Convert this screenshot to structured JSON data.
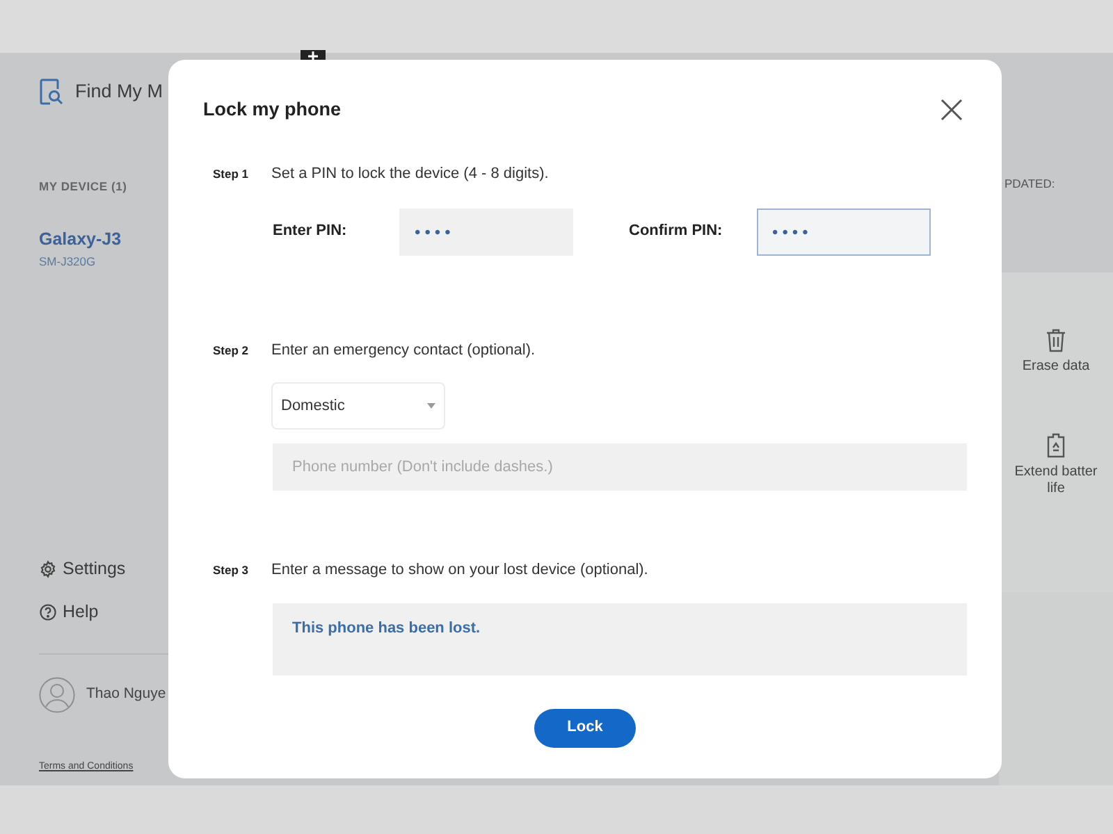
{
  "app": {
    "title": "Find My M"
  },
  "sidebar": {
    "section_label": "MY DEVICE (1)",
    "device": {
      "name": "Galaxy-J3",
      "model": "SM-J320G"
    },
    "links": [
      {
        "label": "Settings"
      },
      {
        "label": "Help"
      }
    ],
    "user": {
      "name": "Thao Nguye"
    },
    "footer_link": "Terms and Conditions"
  },
  "device_panel": {
    "status_label": "PDATED:",
    "actions": [
      {
        "lines": [
          "Erase data"
        ]
      },
      {
        "lines": [
          "Extend batter",
          "life"
        ]
      }
    ]
  },
  "modal": {
    "title": "Lock my phone",
    "step1": {
      "label": "Step 1",
      "instruction": "Set a PIN to lock the device (4 - 8 digits).",
      "pin_fields": [
        {
          "label": "Enter PIN:",
          "value": "••••",
          "focused": false
        },
        {
          "label": "Confirm PIN:",
          "value": "••••",
          "focused": true
        }
      ]
    },
    "step2": {
      "label": "Step 2",
      "instruction": "Enter an emergency contact (optional).",
      "region_select": {
        "value": "Domestic"
      },
      "phone_field": {
        "placeholder": "Phone number (Don't include dashes.)"
      }
    },
    "step3": {
      "label": "Step 3",
      "instruction": "Enter a message to show on your lost device (optional).",
      "message": {
        "value": "This phone has been lost."
      }
    },
    "submit": "Lock"
  }
}
